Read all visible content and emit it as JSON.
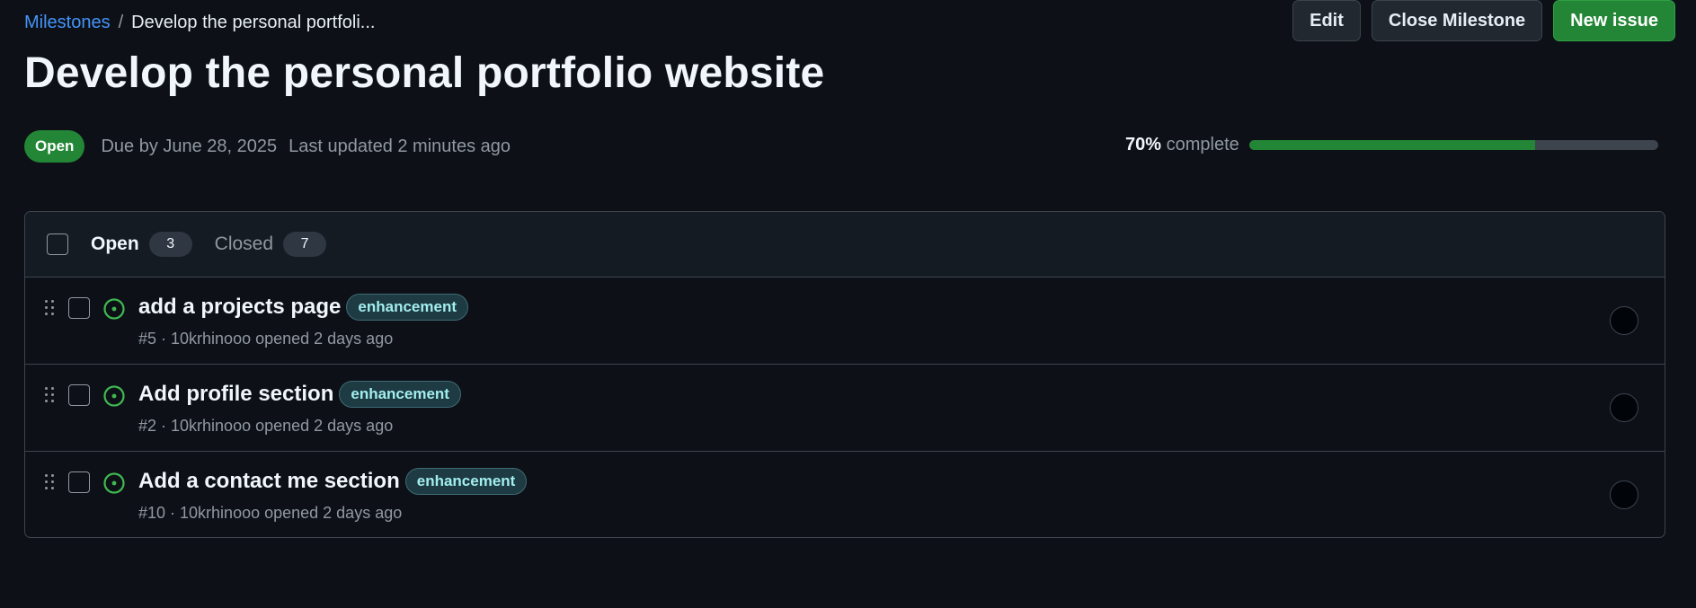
{
  "breadcrumb": {
    "parent": "Milestones",
    "separator": "/",
    "current": "Develop the personal portfoli..."
  },
  "actions": {
    "edit": "Edit",
    "close": "Close Milestone",
    "new_issue": "New issue"
  },
  "milestone": {
    "title": "Develop the personal portfolio website",
    "state": "Open",
    "due": "Due by June 28, 2025",
    "updated": "Last updated 2 minutes ago",
    "percent_label": "70%",
    "complete_label": "complete",
    "progress_fraction": 0.7
  },
  "tabs": {
    "open_label": "Open",
    "open_count": "3",
    "closed_label": "Closed",
    "closed_count": "7"
  },
  "issues": [
    {
      "title": "add a projects page",
      "label": "enhancement",
      "meta": "#5 · 10krhinooo opened 2 days ago"
    },
    {
      "title": "Add profile section",
      "label": "enhancement",
      "meta": "#2 · 10krhinooo opened 2 days ago"
    },
    {
      "title": "Add a contact me section",
      "label": "enhancement",
      "meta": "#10 · 10krhinooo opened 2 days ago"
    }
  ],
  "colors": {
    "background": "#0d1117",
    "accent_green": "#238636",
    "link_blue": "#4493f8",
    "label_text": "#a2eeef"
  },
  "icons": {
    "issue_state": "issue-opened-icon",
    "drag": "grabber-icon"
  }
}
